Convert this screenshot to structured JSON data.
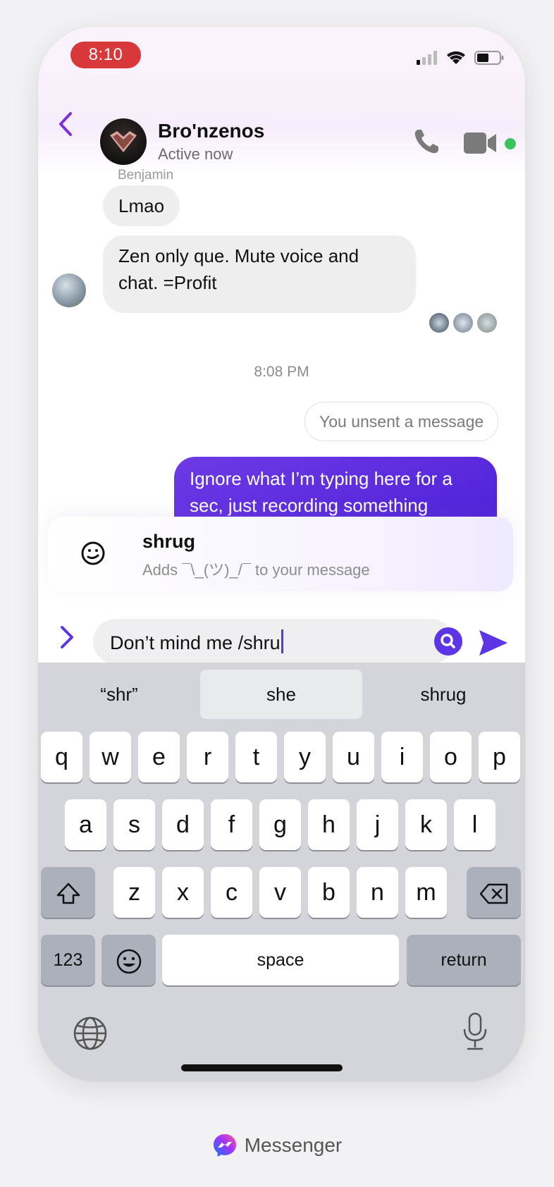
{
  "status_bar": {
    "time": "8:10"
  },
  "header": {
    "title": "Bro'nzenos",
    "subtitle": "Active now"
  },
  "messages": {
    "sender_name": "Benjamin",
    "incoming": [
      "Lmao",
      "Zen only que. Mute voice and chat. =Profit"
    ],
    "timestamp": "8:08 PM",
    "unsent_notice": "You unsent a message",
    "outgoing": "Ignore what I’m typing here for a sec, just recording something"
  },
  "command_suggestion": {
    "name": "shrug",
    "description": "Adds ¯\\_(ツ)_/¯ to your message"
  },
  "composer": {
    "input_value": "Don’t mind me /shru"
  },
  "keyboard": {
    "predictions": [
      "“shr”",
      "she",
      "shrug"
    ],
    "row1": [
      "q",
      "w",
      "e",
      "r",
      "t",
      "y",
      "u",
      "i",
      "o",
      "p"
    ],
    "row2": [
      "a",
      "s",
      "d",
      "f",
      "g",
      "h",
      "j",
      "k",
      "l"
    ],
    "row3": [
      "z",
      "x",
      "c",
      "v",
      "b",
      "n",
      "m"
    ],
    "numbers_label": "123",
    "space_label": "space",
    "return_label": "return"
  },
  "footer": {
    "brand": "Messenger"
  },
  "colors": {
    "accent": "#5b35e6",
    "time_pill": "#d8383a",
    "online": "#3ac35a"
  }
}
